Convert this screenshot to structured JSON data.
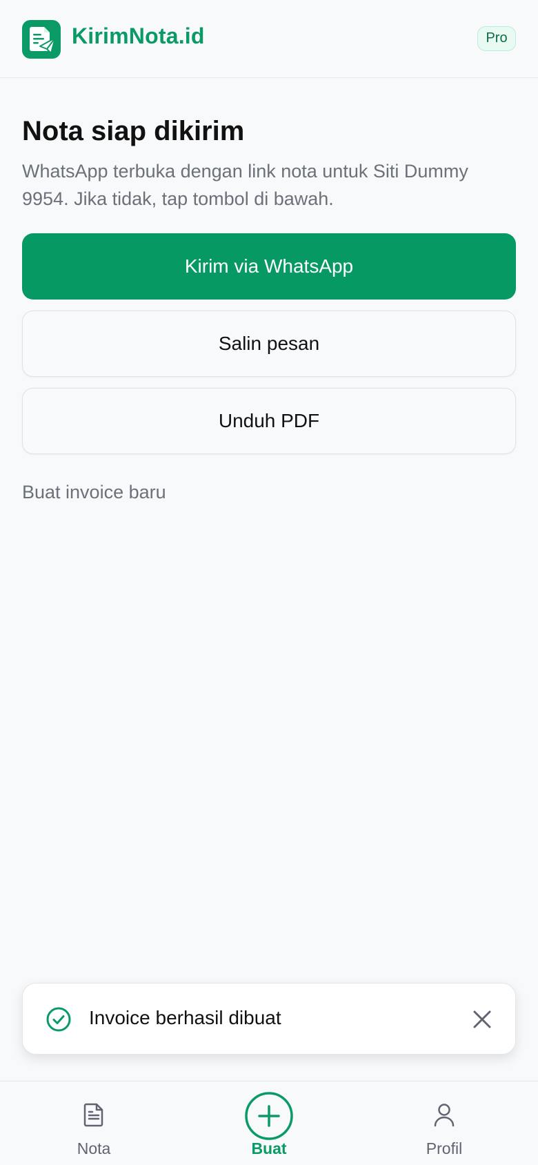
{
  "header": {
    "brand": "KirimNota.id",
    "badge": "Pro",
    "logo_icon": "document-send-icon",
    "accent": "#0a9a66"
  },
  "main": {
    "title": "Nota siap dikirim",
    "description": "WhatsApp terbuka dengan link nota untuk Siti Dummy 9954. Jika tidak, tap tombol di bawah.",
    "buttons": {
      "whatsapp": "Kirim via WhatsApp",
      "copy": "Salin pesan",
      "pdf": "Unduh PDF"
    },
    "new_invoice_link": "Buat invoice baru"
  },
  "toast": {
    "message": "Invoice berhasil dibuat",
    "icon": "check-circle-icon",
    "close_icon": "close-icon"
  },
  "bottom_nav": {
    "items": [
      {
        "label": "Nota",
        "icon": "document-icon"
      },
      {
        "label": "Buat",
        "icon": "plus-circle-icon",
        "active": true
      },
      {
        "label": "Profil",
        "icon": "user-icon"
      }
    ]
  }
}
